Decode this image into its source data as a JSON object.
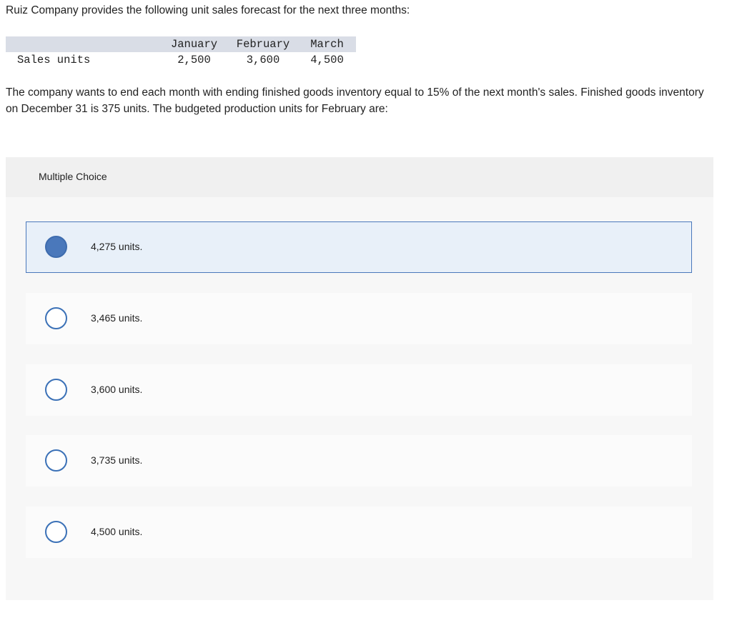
{
  "intro_text": "Ruiz Company provides the following unit sales forecast for the next three months:",
  "forecast_table": {
    "columns": [
      "",
      "January",
      "February",
      "March"
    ],
    "rows": [
      {
        "label": "Sales units",
        "values": [
          "2,500",
          "3,600",
          "4,500"
        ]
      }
    ]
  },
  "question_text": "The company wants to end each month with ending finished goods inventory equal to 15% of the next month's sales. Finished goods inventory on December 31 is 375 units. The budgeted production units for February are:",
  "multiple_choice": {
    "header": "Multiple Choice",
    "selected_index": 0,
    "options": [
      {
        "label": "4,275 units."
      },
      {
        "label": "3,465 units."
      },
      {
        "label": "3,600 units."
      },
      {
        "label": "3,735 units."
      },
      {
        "label": "4,500 units."
      }
    ]
  },
  "colors": {
    "accent": "#4a78bb",
    "selected_background": "#e8f0f9",
    "table_header_background": "#d9dde6",
    "panel_background": "#f7f7f7"
  }
}
